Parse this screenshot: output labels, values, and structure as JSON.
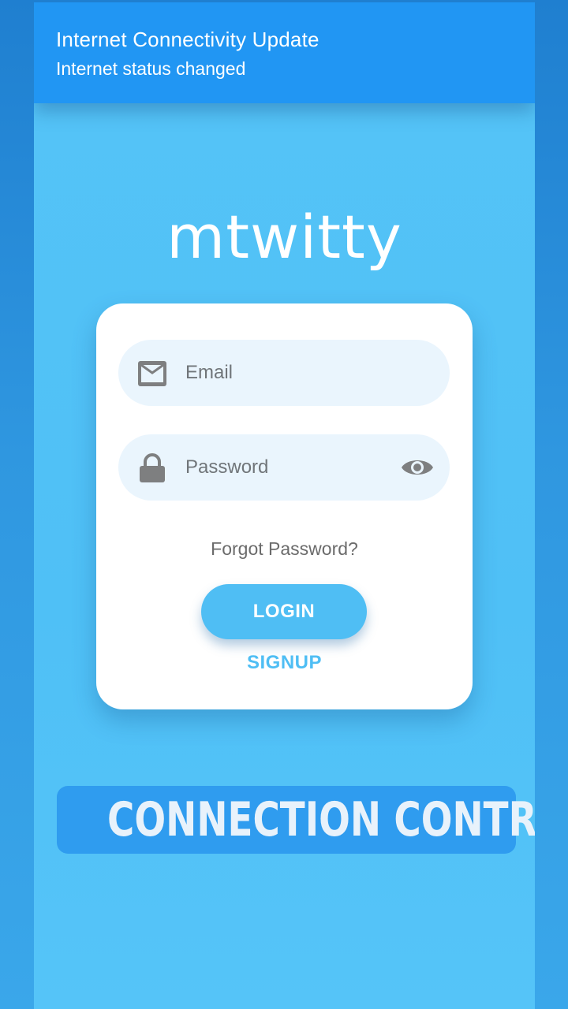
{
  "notification": {
    "title": "Internet Connectivity Update",
    "subtitle": "Internet status changed"
  },
  "app": {
    "brand": "mtwitty"
  },
  "login_form": {
    "email_placeholder": "Email",
    "password_placeholder": "Password",
    "email_icon": "mail-icon",
    "password_icon": "lock-icon",
    "visibility_icon": "eye-icon",
    "forgot_label": "Forgot Password?",
    "login_label": "LOGIN",
    "signup_label": "SIGNUP"
  },
  "banner": {
    "text": "CONNECTION CONTROL"
  },
  "colors": {
    "background": "#4fc0f6",
    "notification": "#2196f3",
    "accent": "#4fbef4",
    "field_bg": "#eaf5fd",
    "banner": "#2f9cef"
  }
}
